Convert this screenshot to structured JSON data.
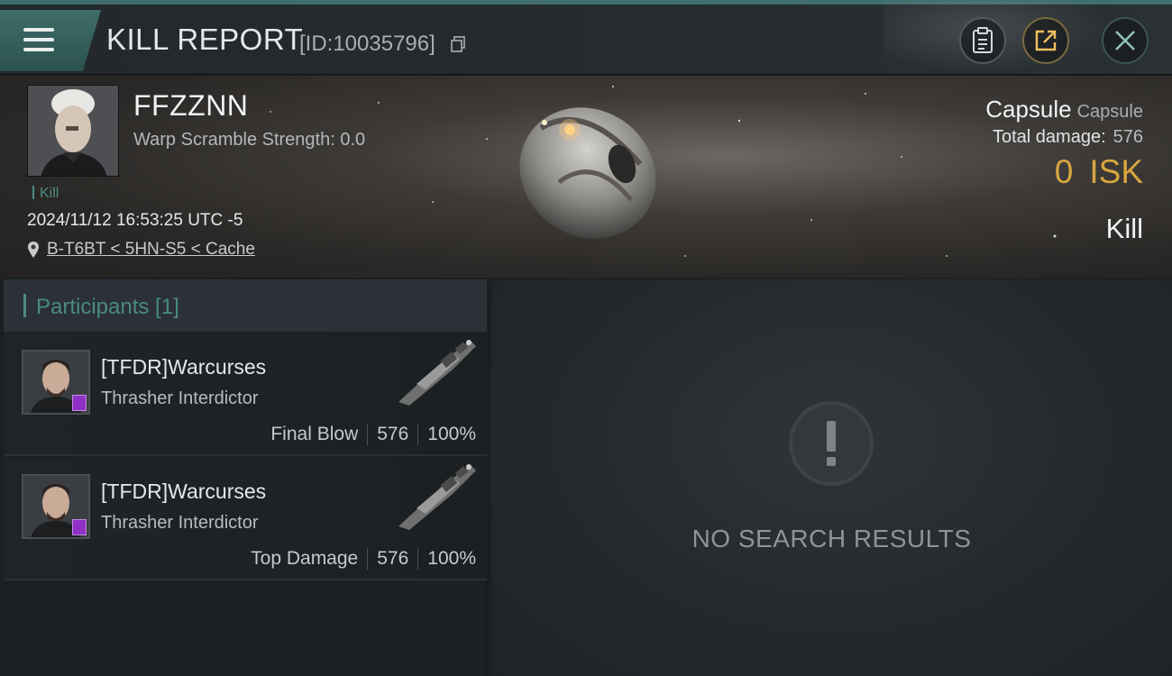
{
  "header": {
    "title": "KILL REPORT",
    "id_label": "[ID:10035796]"
  },
  "victim": {
    "name": "FFZZNN",
    "subtitle": "Warp Scramble Strength: 0.0",
    "tag": "Kill",
    "datetime": "2024/11/12 16:53:25 UTC -5",
    "location": "B-T6BT < 5HN-S5 < Cache",
    "ship_name": "Capsule",
    "ship_class": "Capsule",
    "damage_label": "Total damage:",
    "damage_value": "576",
    "isk_value": "0",
    "isk_unit": "ISK",
    "result": "Kill"
  },
  "participants": {
    "header_label": "Participants [1]",
    "items": [
      {
        "name": "[TFDR]Warcurses",
        "ship": "Thrasher Interdictor",
        "role": "Final Blow",
        "damage": "576",
        "percent": "100%"
      },
      {
        "name": "[TFDR]Warcurses",
        "ship": "Thrasher Interdictor",
        "role": "Top Damage",
        "damage": "576",
        "percent": "100%"
      }
    ]
  },
  "results": {
    "empty_text": "NO SEARCH RESULTS"
  },
  "colors": {
    "accent_teal": "#4a8a85",
    "isk_gold": "#d8a640",
    "badge_purple": "#8e31c4"
  }
}
